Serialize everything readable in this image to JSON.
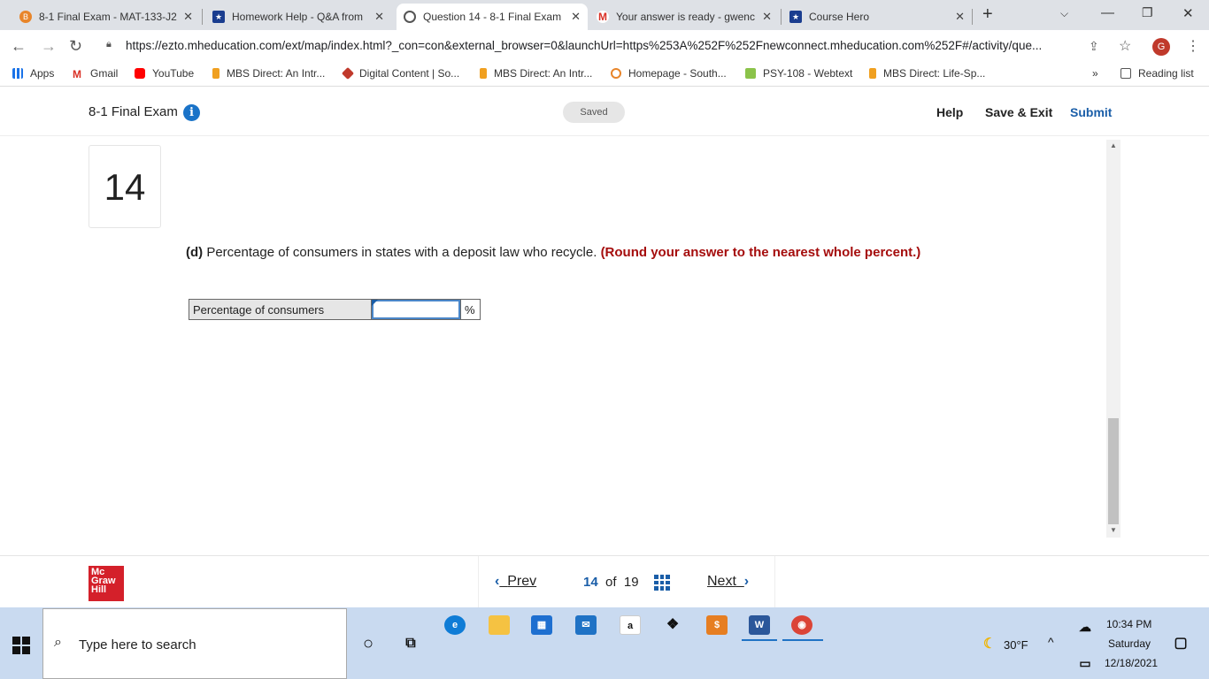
{
  "browser": {
    "tabs": [
      {
        "title": "8-1 Final Exam - MAT-133-J2",
        "active": false
      },
      {
        "title": "Homework Help - Q&A from",
        "active": false
      },
      {
        "title": "Question 14 - 8-1 Final Exam",
        "active": true
      },
      {
        "title": "Your answer is ready - gwenc",
        "active": false
      },
      {
        "title": "Course Hero",
        "active": false
      }
    ],
    "url": "https://ezto.mheducation.com/ext/map/index.html?_con=con&external_browser=0&launchUrl=https%253A%252F%252Fnewconnect.mheducation.com%252F#/activity/que...",
    "avatar_letter": "G",
    "bookmarks": [
      "Apps",
      "Gmail",
      "YouTube",
      "MBS Direct: An Intr...",
      "Digital Content | So...",
      "MBS Direct: An Intr...",
      "Homepage - South...",
      "PSY-108 - Webtext",
      "MBS Direct: Life-Sp..."
    ],
    "reading_list": "Reading list"
  },
  "exam": {
    "title": "8-1 Final Exam",
    "saved": "Saved",
    "help": "Help",
    "save_exit": "Save & Exit",
    "submit": "Submit"
  },
  "question": {
    "number": "14",
    "part": "(d)",
    "text": "Percentage of consumers in states with a deposit law who recycle.",
    "instruction": "(Round your answer to the nearest whole percent.)",
    "row_label": "Percentage of consumers",
    "input_value": "",
    "unit": "%"
  },
  "footer": {
    "logo": [
      "Mc",
      "Graw",
      "Hill"
    ],
    "prev": "Prev",
    "current": "14",
    "of": "of",
    "total": "19",
    "next": "Next"
  },
  "taskbar": {
    "search_placeholder": "Type here to search",
    "weather": "30°F",
    "time": "10:34 PM",
    "day": "Saturday",
    "date": "12/18/2021"
  }
}
